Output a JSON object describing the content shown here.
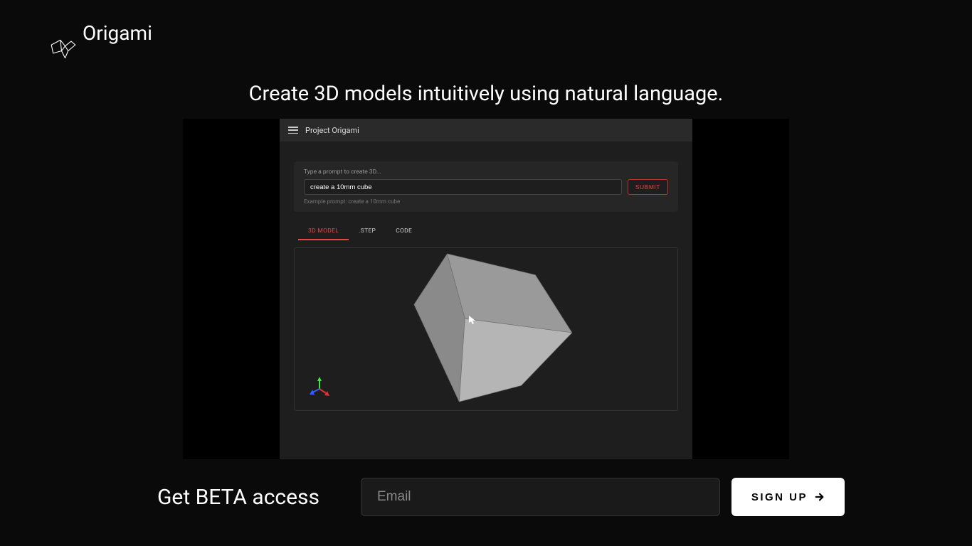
{
  "brand": "Origami",
  "tagline": "Create 3D models intuitively using natural language.",
  "demo": {
    "title": "Project Origami",
    "prompt_label": "Type a prompt to create 3D...",
    "prompt_value": "create a 10mm cube",
    "submit_label": "SUBMIT",
    "example_hint": "Example prompt: create a 10mm cube",
    "tabs": [
      {
        "label": "3D MODEL",
        "active": true
      },
      {
        "label": ".STEP",
        "active": false
      },
      {
        "label": "CODE",
        "active": false
      }
    ]
  },
  "cta": {
    "heading": "Get BETA access",
    "email_placeholder": "Email",
    "signup_label": "SIGN UP"
  },
  "colors": {
    "accent": "#e84545",
    "bg": "#0a0a0a",
    "panel": "#1e1e1e"
  }
}
